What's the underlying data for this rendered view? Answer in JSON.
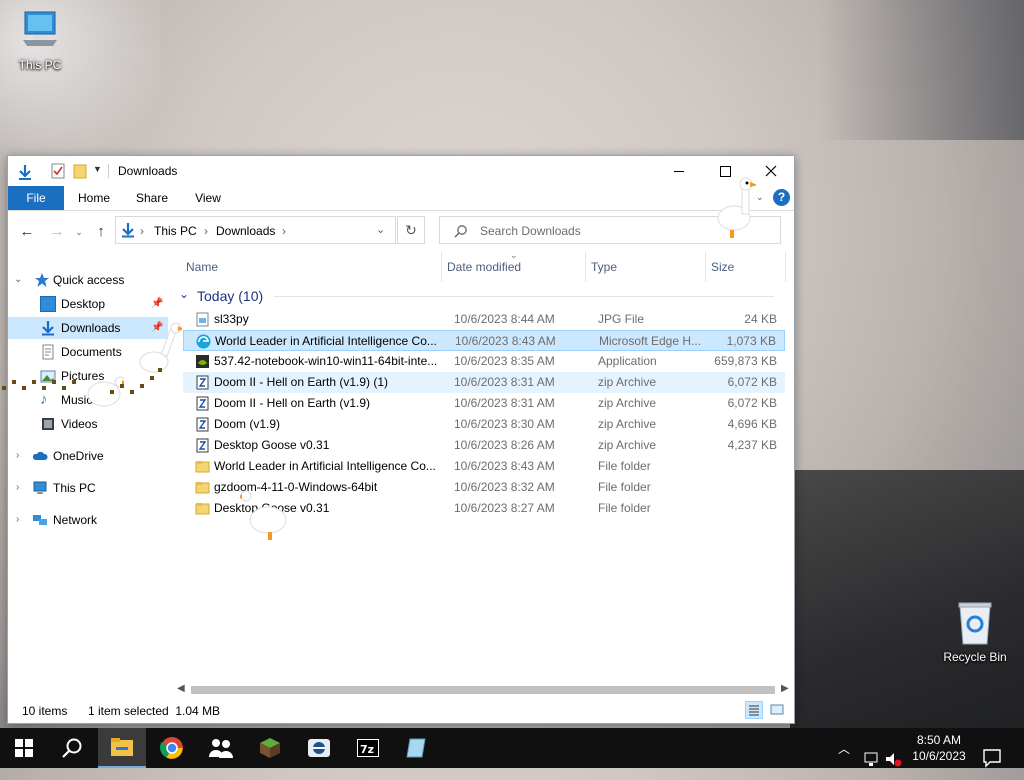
{
  "desktop": {
    "icons": [
      {
        "label": "This PC",
        "icon": "this-pc-icon"
      },
      {
        "label": "Recycle Bin",
        "icon": "recycle-bin-icon"
      }
    ]
  },
  "window": {
    "title": "Downloads",
    "ribbon_tabs": [
      "File",
      "Home",
      "Share",
      "View"
    ],
    "help_label": "?",
    "breadcrumb": [
      "This PC",
      "Downloads"
    ],
    "search_placeholder": "Search Downloads"
  },
  "navpane": {
    "items": [
      {
        "label": "Quick access",
        "icon": "star-icon"
      },
      {
        "label": "Desktop",
        "icon": "desktop-folder-icon"
      },
      {
        "label": "Downloads",
        "icon": "download-arrow-icon"
      },
      {
        "label": "Documents",
        "icon": "documents-icon"
      },
      {
        "label": "Pictures",
        "icon": "pictures-icon"
      },
      {
        "label": "Music",
        "icon": "music-icon"
      },
      {
        "label": "Videos",
        "icon": "videos-icon"
      },
      {
        "label": "OneDrive",
        "icon": "cloud-icon"
      },
      {
        "label": "This PC",
        "icon": "this-pc-icon"
      },
      {
        "label": "Network",
        "icon": "network-icon"
      }
    ]
  },
  "columns": [
    "Name",
    "Date modified",
    "Type",
    "Size"
  ],
  "group_label": "Today (10)",
  "files": [
    {
      "name": "sl33py",
      "date": "10/6/2023 8:44 AM",
      "type": "JPG File",
      "size": "24 KB",
      "icon": "image-file-icon"
    },
    {
      "name": "World Leader in Artificial Intelligence Co...",
      "date": "10/6/2023 8:43 AM",
      "type": "Microsoft Edge H...",
      "size": "1,073 KB",
      "icon": "edge-html-icon"
    },
    {
      "name": "537.42-notebook-win10-win11-64bit-inte...",
      "date": "10/6/2023 8:35 AM",
      "type": "Application",
      "size": "659,873 KB",
      "icon": "nvidia-app-icon"
    },
    {
      "name": "Doom II - Hell on Earth (v1.9) (1)",
      "date": "10/6/2023 8:31 AM",
      "type": "zip Archive",
      "size": "6,072 KB",
      "icon": "zip-archive-icon"
    },
    {
      "name": "Doom II - Hell on Earth (v1.9)",
      "date": "10/6/2023 8:31 AM",
      "type": "zip Archive",
      "size": "6,072 KB",
      "icon": "zip-archive-icon"
    },
    {
      "name": "Doom (v1.9)",
      "date": "10/6/2023 8:30 AM",
      "type": "zip Archive",
      "size": "4,696 KB",
      "icon": "zip-archive-icon"
    },
    {
      "name": "Desktop Goose v0.31",
      "date": "10/6/2023 8:26 AM",
      "type": "zip Archive",
      "size": "4,237 KB",
      "icon": "zip-archive-icon"
    },
    {
      "name": "World Leader in Artificial Intelligence Co...",
      "date": "10/6/2023 8:43 AM",
      "type": "File folder",
      "size": "",
      "icon": "folder-icon"
    },
    {
      "name": "gzdoom-4-11-0-Windows-64bit",
      "date": "10/6/2023 8:32 AM",
      "type": "File folder",
      "size": "",
      "icon": "folder-icon"
    },
    {
      "name": "Desktop Goose v0.31",
      "date": "10/6/2023 8:27 AM",
      "type": "File folder",
      "size": "",
      "icon": "folder-icon"
    }
  ],
  "status": {
    "count": "10 items",
    "selection": "1 item selected  1.04 MB"
  },
  "taskbar": {
    "apps": [
      "start-icon",
      "search-icon",
      "file-explorer-icon",
      "chrome-icon",
      "people-icon",
      "minecraft-icon",
      "app-icon",
      "7zip-icon",
      "notepad-icon"
    ],
    "time": "8:50 AM",
    "date": "10/6/2023"
  }
}
